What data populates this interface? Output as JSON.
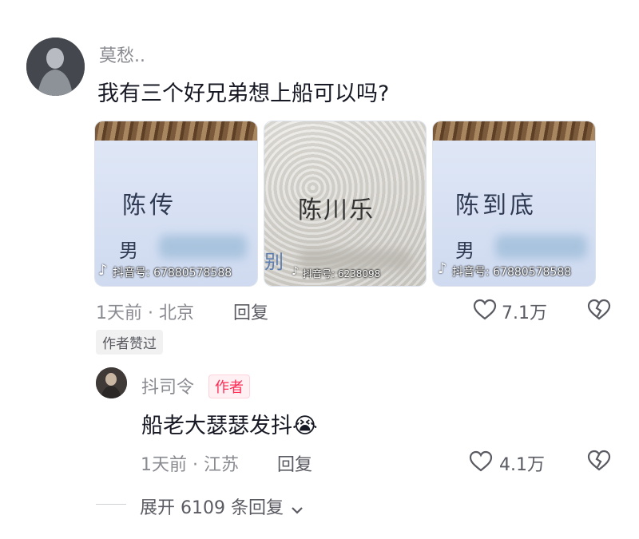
{
  "comment": {
    "username": "莫愁..",
    "text": "我有三个好兄弟想上船可以吗?",
    "time_location": "1天前 · 北京",
    "reply_label": "回复",
    "like_count": "7.1万",
    "author_liked_badge": "作者赞过",
    "images": [
      {
        "name": "陈传",
        "gender": "男",
        "watermark": "抖音号: 67880578588"
      },
      {
        "name": "陈川乐",
        "gender": "别",
        "watermark": "抖音号: 6238098"
      },
      {
        "name": "陈到底",
        "gender": "男",
        "watermark": "抖音号: 67880578588"
      }
    ]
  },
  "reply": {
    "username": "抖司令",
    "author_badge": "作者",
    "text": "船老大瑟瑟发抖",
    "emoji": "😭",
    "time_location": "1天前 · 江苏",
    "reply_label": "回复",
    "like_count": "4.1万"
  },
  "expand_replies": "展开 6109 条回复",
  "colors": {
    "accent": "#fe2c55",
    "muted": "#8a8b91"
  },
  "icons": [
    "heart-icon",
    "broken-heart-icon",
    "chevron-down-icon",
    "tiktok-logo-icon"
  ]
}
